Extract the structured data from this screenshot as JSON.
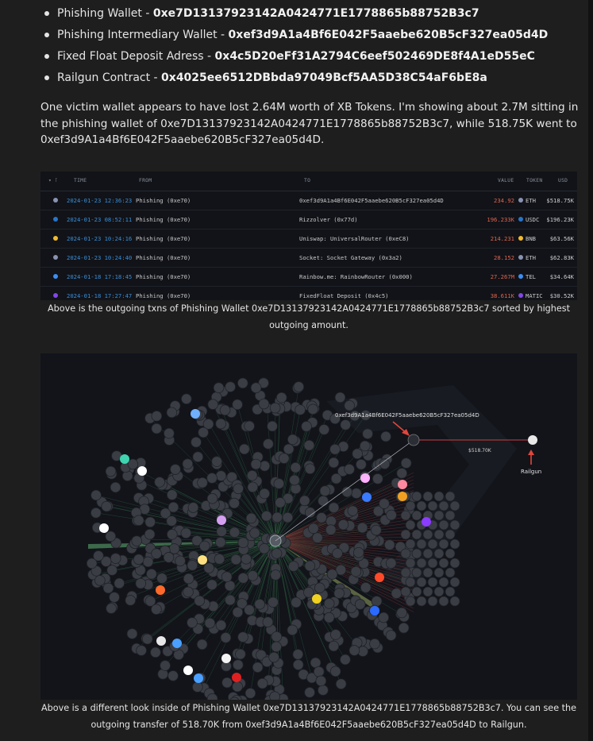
{
  "addresses": [
    {
      "label": "Phishing Wallet - ",
      "value": "0xe7D13137923142A0424771E1778865b88752B3c7"
    },
    {
      "label": "Phishing Intermediary Wallet - ",
      "value": "0xef3d9A1a4Bf6E042F5aaebe620B5cF327ea05d4D"
    },
    {
      "label": "Fixed Float Deposit Adress - ",
      "value": "0x4c5D20eFf31A2794C6eef502469DE8f4A1eD55eC"
    },
    {
      "label": "Railgun Contract - ",
      "value": "0x4025ee6512DBbda97049Bcf5AA5D38C54aF6bE8a"
    }
  ],
  "paragraph": "One victim wallet appears to have lost 2.64M worth of XB Tokens. I'm showing about 2.7M sitting in the phishing wallet of 0xe7D13137923142A0424771E1778865b88752B3c7, while 518.75K went to 0xef3d9A1a4Bf6E042F5aaebe620B5cF327ea05d4D.",
  "tx_table": {
    "headers": {
      "time": "TIME",
      "from": "FROM",
      "to": "TO",
      "value": "VALUE",
      "token": "TOKEN",
      "usd": "USD"
    },
    "rows": [
      {
        "time": "2024-01-23 12:36:23",
        "from": "Phishing (0xe70)",
        "to": "0xef3d9A1a4Bf6E042F5aaebe620B5cF327ea05d4D",
        "value": "234.92",
        "token": "ETH",
        "usd": "$518.75K",
        "color": "#8a92b2"
      },
      {
        "time": "2024-01-23 08:52:11",
        "from": "Phishing (0xe70)",
        "to": "Rizzolver (0x77d)",
        "value": "196.233K",
        "token": "USDC",
        "usd": "$196.23K",
        "color": "#2775ca"
      },
      {
        "time": "2024-01-23 10:24:16",
        "from": "Phishing (0xe70)",
        "to": "Uniswap: UniversalRouter (0xeC8)",
        "value": "214.231",
        "token": "BNB",
        "usd": "$63.56K",
        "color": "#f3ba2f"
      },
      {
        "time": "2024-01-23 10:24:40",
        "from": "Phishing (0xe70)",
        "to": "Socket: Socket Gateway (0x3a2)",
        "value": "28.152",
        "token": "ETH",
        "usd": "$62.83K",
        "color": "#8a92b2"
      },
      {
        "time": "2024-01-18 17:18:45",
        "from": "Phishing (0xe70)",
        "to": "Rainbow.me: RainbowRouter (0x000)",
        "value": "27.267M",
        "token": "TEL",
        "usd": "$34.64K",
        "color": "#3c8ef5"
      },
      {
        "time": "2024-01-18 17:27:47",
        "from": "Phishing (0xe70)",
        "to": "FixedFloat Deposit (0x4c5)",
        "value": "38.611K",
        "token": "MATIC",
        "usd": "$30.52K",
        "color": "#8247e5"
      }
    ]
  },
  "caption1": "Above is the outgoing txns of Phishing Wallet 0xe7D13137923142A0424771E1778865b88752B3c7 sorted by highest outgoing amount.",
  "graph": {
    "target_label": "0xef3d9A1a4Bf6E042F5aaebe620B5cF327ea05d4D",
    "amount_label": "$518.70K",
    "railgun_label": "Railgun"
  },
  "caption2": "Above is a different look inside of Phishing Wallet 0xe7D13137923142A0424771E1778865b88752B3c7. You can see the outgoing transfer of 518.70K from 0xef3d9A1a4Bf6E042F5aaebe620B5cF327ea05d4D to Railgun.",
  "colors": {
    "background": "#1e1e1e",
    "accent_red": "#e0463c",
    "link_blue": "#3b8ed8"
  }
}
